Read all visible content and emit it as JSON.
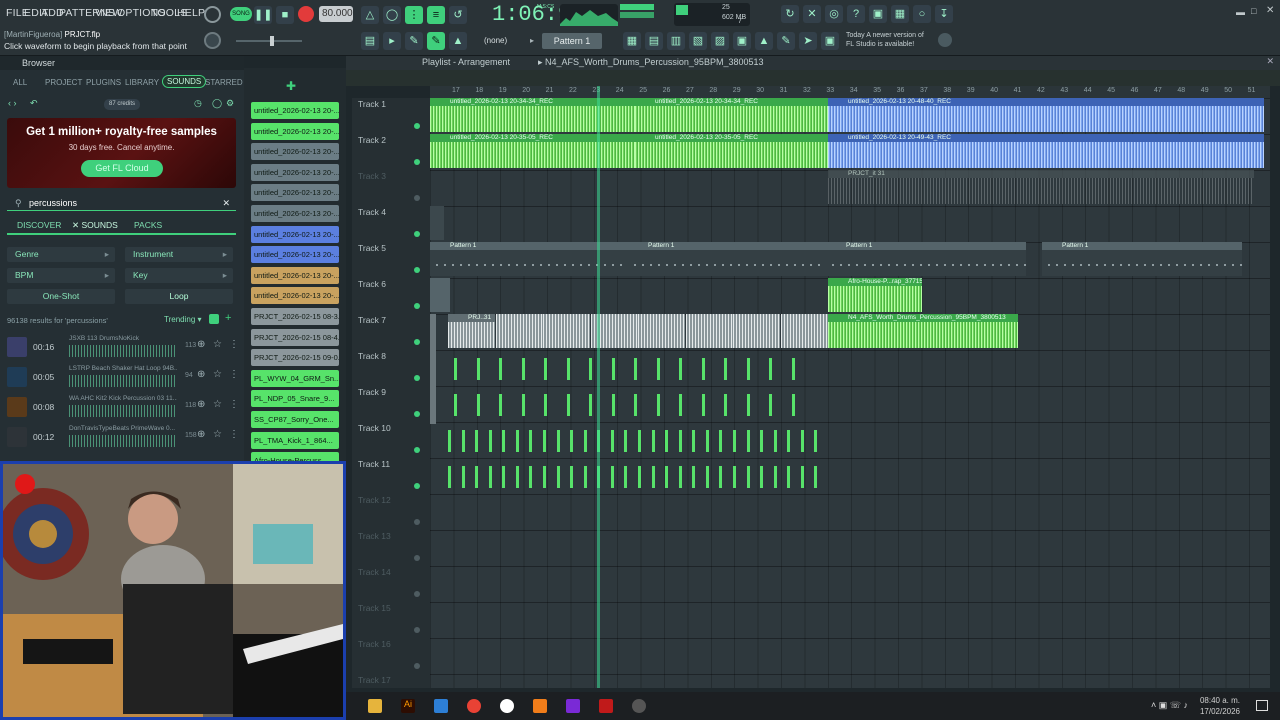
{
  "menu": [
    "FILE",
    "EDIT",
    "ADD",
    "PATTERNS",
    "VIEW",
    "OPTIONS",
    "TOOLS",
    "HELP"
  ],
  "project": {
    "user": "[MartinFigueroa]",
    "file": "PRJCT.flp",
    "hint": "Click waveform to begin playback from that point"
  },
  "transport": {
    "mode": "SONG",
    "tempo": "80.000",
    "time": "1:06:91",
    "time_unit": "M:S:CS",
    "memory": "602 MB",
    "cpu": "25",
    "voices": "7"
  },
  "toolbar2": {
    "snap": "(none)",
    "pattern": "Pattern 1"
  },
  "news": {
    "line1": "Today  A newer version of",
    "line2": "FL Studio is available!"
  },
  "browser": {
    "title": "Browser",
    "tabs": [
      "ALL",
      "PROJECT",
      "PLUGINS",
      "LIBRARY",
      "SOUNDS",
      "STARRED"
    ],
    "active_tab": "SOUNDS",
    "credits": "87 credits",
    "ad": {
      "title": "Get 1 million+ royalty-free samples",
      "sub": "30 days free. Cancel anytime.",
      "button": "Get FL Cloud"
    },
    "search": "percussions",
    "subtabs": [
      "DISCOVER",
      "SOUNDS",
      "PACKS"
    ],
    "filters": [
      "Genre",
      "Instrument",
      "BPM",
      "Key",
      "One-Shot",
      "Loop"
    ],
    "results_count": "96138 results for 'percussions'",
    "sort": "Trending",
    "results": [
      {
        "dur": "00:16",
        "name": "JSXB 113 DrumsNoKick",
        "bpm": "113"
      },
      {
        "dur": "00:05",
        "name": "LSTRP Beach Shaker Hat Loop 94B...",
        "bpm": "94"
      },
      {
        "dur": "00:08",
        "name": "WA AHC Kit2 Kick Percussion 03 11...",
        "bpm": "118"
      },
      {
        "dur": "00:12",
        "name": "DonTravisTypeBeats PrimeWave 0...",
        "bpm": "158"
      }
    ]
  },
  "patterns": [
    {
      "name": "untitled_2026-02-13 20-...",
      "color": "#57e36a"
    },
    {
      "name": "untitled_2026-02-13 20-...",
      "color": "#57e36a"
    },
    {
      "name": "untitled_2026-02-13 20-...",
      "color": "#6b7d85"
    },
    {
      "name": "untitled_2026-02-13 20-...",
      "color": "#6b7d85"
    },
    {
      "name": "untitled_2026-02-13 20-...",
      "color": "#6b7d85"
    },
    {
      "name": "untitled_2026-02-13 20-...",
      "color": "#6b7d85"
    },
    {
      "name": "untitled_2026-02-13 20-...",
      "color": "#5b7fe0"
    },
    {
      "name": "untitled_2026-02-13 20-...",
      "color": "#5b7fe0"
    },
    {
      "name": "untitled_2026-02-13 20-...",
      "color": "#c9a25f"
    },
    {
      "name": "untitled_2026-02-13 20-...",
      "color": "#c9a25f"
    },
    {
      "name": "PRJCT_2026-02-15 08-3...",
      "color": "#8c979c"
    },
    {
      "name": "PRJCT_2026-02-15 08-4...",
      "color": "#8c979c"
    },
    {
      "name": "PRJCT_2026-02-15 09-0...",
      "color": "#8c979c"
    },
    {
      "name": "PL_WYW_04_GRM_Sn...",
      "color": "#57e36a"
    },
    {
      "name": "PL_NDP_05_Snare_9...",
      "color": "#57e36a"
    },
    {
      "name": "SS_CP87_Sorry_One...",
      "color": "#57e36a"
    },
    {
      "name": "PL_TMA_Kick_1_864...",
      "color": "#57e36a"
    },
    {
      "name": "Afro-House-Percuss...",
      "color": "#57e36a"
    }
  ],
  "playlist": {
    "title": "Playlist - Arrangement",
    "current": "N4_AFS_Worth_Drums_Percussion_95BPM_3800513",
    "ruler": [
      "17",
      "18",
      "19",
      "20",
      "21",
      "22",
      "23",
      "24",
      "25",
      "26",
      "27",
      "28",
      "29",
      "30",
      "31",
      "32",
      "33",
      "34",
      "35",
      "36",
      "37",
      "38",
      "39",
      "40",
      "41",
      "42",
      "43",
      "44",
      "45",
      "46",
      "47",
      "48",
      "49",
      "50",
      "51"
    ],
    "tracks": [
      "Track 1",
      "Track 2",
      "Track 3",
      "Track 4",
      "Track 5",
      "Track 6",
      "Track 7",
      "Track 8",
      "Track 9",
      "Track 10",
      "Track 11",
      "Track 12",
      "Track 13",
      "Track 14",
      "Track 15",
      "Track 16",
      "Track 17"
    ],
    "clip_labels": {
      "t1a": "untitled_2026-02-13 20-34-34_REC",
      "t1b": "untitled_2026-02-13 20-34-34_REC",
      "t1c": "untitled_2026-02-13 20-48-40_REC",
      "t2a": "untitled_2026-02-13 20-35-05_REC",
      "t2b": "untitled_2026-02-13 20-35-05_REC",
      "t2c": "untitled_2026-02-13 20-49-43_REC",
      "t3": "PRJCT_it 31",
      "t5": "Pattern 1",
      "t6": "Afro-House-P...rap_3771544",
      "t7a": "PRJ..31",
      "t7b": "N4_AFS_Worth_Drums_Percussion_95BPM_3800513"
    }
  },
  "taskbar": {
    "time": "08:40 a. m.",
    "date": "17/02/2026"
  },
  "colors": {
    "accent": "#3fd07c",
    "audio_green": "#57e36a",
    "audio_blue": "#5b7fe0"
  }
}
